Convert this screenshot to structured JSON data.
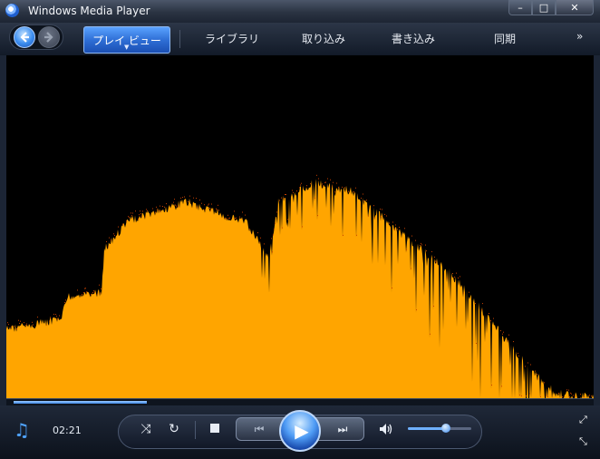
{
  "window": {
    "title": "Windows Media Player",
    "caption_buttons": {
      "minimize": "–",
      "maximize": "□",
      "close": "✕"
    }
  },
  "nav": {
    "back_icon": "back-arrow-icon",
    "forward_icon": "forward-arrow-icon",
    "tabs": [
      "プレイ ビュー",
      "ライブラリ",
      "取り込み",
      "書き込み",
      "同期"
    ],
    "active_tab": "プレイ ビュー",
    "more": "»"
  },
  "visualization": {
    "type": "spectrum-bars",
    "color": "#ffa500",
    "peak_color": "#c84000",
    "background": "#000000"
  },
  "seek": {
    "progress_fraction": 0.23
  },
  "controls": {
    "time": "02:21",
    "shuffle": "⤨",
    "repeat": "↻",
    "prev": "⏮",
    "next": "⏭",
    "play": "▶",
    "volume": "🔊",
    "volume_fraction": 0.6,
    "fullscreen": "⤢",
    "minimode": "⤡",
    "note": "♫"
  },
  "colors": {
    "accent": "#3d86e6",
    "frame": "#1b2433"
  }
}
